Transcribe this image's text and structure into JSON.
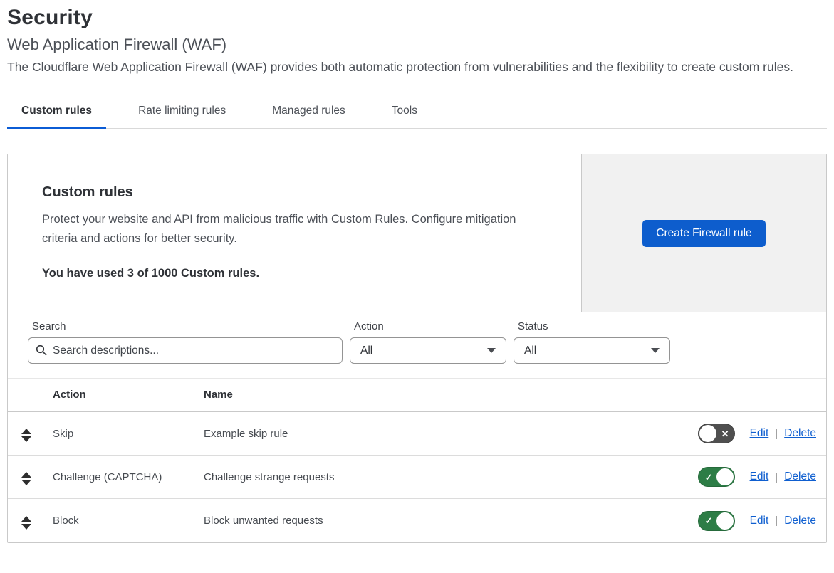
{
  "page": {
    "title": "Security",
    "subtitle": "Web Application Firewall (WAF)",
    "description": "The Cloudflare Web Application Firewall (WAF) provides both automatic protection from vulnerabilities and the flexibility to create custom rules."
  },
  "tabs": [
    {
      "label": "Custom rules",
      "active": true
    },
    {
      "label": "Rate limiting rules",
      "active": false
    },
    {
      "label": "Managed rules",
      "active": false
    },
    {
      "label": "Tools",
      "active": false
    }
  ],
  "card": {
    "title": "Custom rules",
    "description": "Protect your website and API from malicious traffic with Custom Rules. Configure mitigation criteria and actions for better security.",
    "usage": "You have used 3 of 1000 Custom rules.",
    "create_button": "Create Firewall rule"
  },
  "filters": {
    "search_label": "Search",
    "search_placeholder": "Search descriptions...",
    "action_label": "Action",
    "action_value": "All",
    "status_label": "Status",
    "status_value": "All"
  },
  "table": {
    "columns": {
      "action": "Action",
      "name": "Name"
    },
    "rows": [
      {
        "action": "Skip",
        "name": "Example skip rule",
        "enabled": false
      },
      {
        "action": "Challenge (CAPTCHA)",
        "name": "Challenge strange requests",
        "enabled": true
      },
      {
        "action": "Block",
        "name": "Block unwanted requests",
        "enabled": true
      }
    ],
    "edit_label": "Edit",
    "delete_label": "Delete"
  },
  "icons": {
    "check": "✓",
    "cross": "✕",
    "search": "magnifier",
    "dropdown_caret": "chevron-down",
    "drag_handle": "reorder-arrows"
  },
  "colors": {
    "primary_button_blue": "#0d5dcd",
    "tab_underline_blue": "#0b5cd5",
    "link_blue": "#0f5fd0",
    "toggle_on_green": "#2d7d46",
    "toggle_off_gray": "#4f4f4f",
    "panel_gray": "#f1f1f1"
  }
}
